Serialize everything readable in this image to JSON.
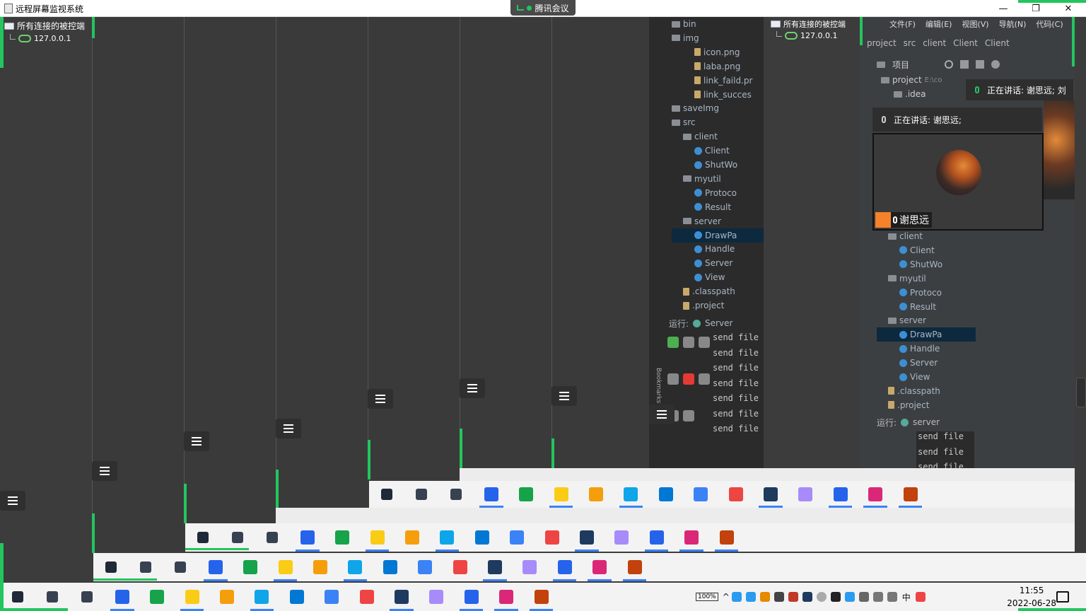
{
  "window": {
    "title": "远程屏幕监视系统",
    "minimize": "—",
    "restore": "❐",
    "close": "✕"
  },
  "meeting": {
    "app_name": "腾讯会议",
    "speaking_label": "正在讲话: 谢思远;",
    "speaking_label_2": "正在讲话: 谢思远; 刘",
    "participant_name": "谢思远"
  },
  "tree": {
    "root_label": "所有连接的被控端",
    "client_ip": "127.0.0.1",
    "nested_root_label": "所有连接的被控端",
    "nested_client_ip": "127.0.0.1"
  },
  "ide_project": {
    "items": [
      {
        "label": "bin",
        "kind": "folder",
        "indent": 0
      },
      {
        "label": "img",
        "kind": "folder",
        "indent": 0
      },
      {
        "label": "icon.png",
        "kind": "file",
        "indent": 2
      },
      {
        "label": "laba.png",
        "kind": "file",
        "indent": 2
      },
      {
        "label": "link_faild.pr",
        "kind": "file",
        "indent": 2
      },
      {
        "label": "link_succes",
        "kind": "file",
        "indent": 2
      },
      {
        "label": "saveImg",
        "kind": "folder",
        "indent": 0
      },
      {
        "label": "src",
        "kind": "folder",
        "indent": 0
      },
      {
        "label": "client",
        "kind": "folder",
        "indent": 1
      },
      {
        "label": "Client",
        "kind": "class",
        "indent": 2
      },
      {
        "label": "ShutWo",
        "kind": "class",
        "indent": 2
      },
      {
        "label": "myutil",
        "kind": "folder",
        "indent": 1
      },
      {
        "label": "Protoco",
        "kind": "class",
        "indent": 2
      },
      {
        "label": "Result",
        "kind": "class",
        "indent": 2
      },
      {
        "label": "server",
        "kind": "folder",
        "indent": 1
      },
      {
        "label": "DrawPa",
        "kind": "class",
        "indent": 2
      },
      {
        "label": "Handle",
        "kind": "class",
        "indent": 2
      },
      {
        "label": "Server",
        "kind": "class",
        "indent": 2
      },
      {
        "label": "View",
        "kind": "class",
        "indent": 2
      },
      {
        "label": ".classpath",
        "kind": "file",
        "indent": 1
      },
      {
        "label": ".project",
        "kind": "file",
        "indent": 1
      }
    ],
    "run_label": "运行:",
    "run_config": "Server",
    "console_line": "send file",
    "bookmarks": "Bookmarks"
  },
  "ide_right": {
    "menu": [
      "文件(F)",
      "编辑(E)",
      "视图(V)",
      "导航(N)",
      "代码(C)"
    ],
    "breadcrumb": [
      "project",
      "src",
      "client",
      "Client",
      "Client"
    ],
    "toolbar_label": "项目",
    "project_label": "project",
    "project_path": "E:\\co",
    "idea_label": ".idea",
    "items": [
      {
        "label": "client",
        "kind": "folder",
        "indent": 1
      },
      {
        "label": "Client",
        "kind": "class",
        "indent": 2
      },
      {
        "label": "ShutWo",
        "kind": "class",
        "indent": 2
      },
      {
        "label": "myutil",
        "kind": "folder",
        "indent": 1
      },
      {
        "label": "Protoco",
        "kind": "class",
        "indent": 2
      },
      {
        "label": "Result",
        "kind": "class",
        "indent": 2
      },
      {
        "label": "server",
        "kind": "folder",
        "indent": 1
      },
      {
        "label": "DrawPa",
        "kind": "class",
        "indent": 2
      },
      {
        "label": "Handle",
        "kind": "class",
        "indent": 2
      },
      {
        "label": "Server",
        "kind": "class",
        "indent": 2
      },
      {
        "label": "View",
        "kind": "class",
        "indent": 2
      },
      {
        "label": ".classpath",
        "kind": "file",
        "indent": 1
      },
      {
        "label": ".project",
        "kind": "file",
        "indent": 1
      }
    ],
    "run_label": "运行:",
    "run_config": "server",
    "console_line": "send file"
  },
  "taskbar": {
    "apps": [
      {
        "name": "start-icon",
        "color": "#1f2937"
      },
      {
        "name": "search-icon",
        "color": "#374151"
      },
      {
        "name": "task-view-icon",
        "color": "#374151"
      },
      {
        "name": "todo-icon",
        "color": "#2563eb"
      },
      {
        "name": "pycharm-icon",
        "color": "#16a34a"
      },
      {
        "name": "music-icon",
        "color": "#facc15"
      },
      {
        "name": "file-explorer-icon",
        "color": "#f59e0b"
      },
      {
        "name": "edge-icon",
        "color": "#0ea5e9"
      },
      {
        "name": "vscode-icon",
        "color": "#0078d4"
      },
      {
        "name": "wps-icon",
        "color": "#3b82f6"
      },
      {
        "name": "chrome-icon",
        "color": "#ef4444"
      },
      {
        "name": "steam-icon",
        "color": "#1e3a5f"
      },
      {
        "name": "game-icon",
        "color": "#a78bfa"
      },
      {
        "name": "tencent-meeting-icon",
        "color": "#2563eb"
      },
      {
        "name": "intellij-icon",
        "color": "#db2777"
      },
      {
        "name": "java-icon",
        "color": "#c2410c"
      }
    ],
    "battery": "100%",
    "ime": "中",
    "time": "11:55",
    "date": "2022-06-28"
  }
}
